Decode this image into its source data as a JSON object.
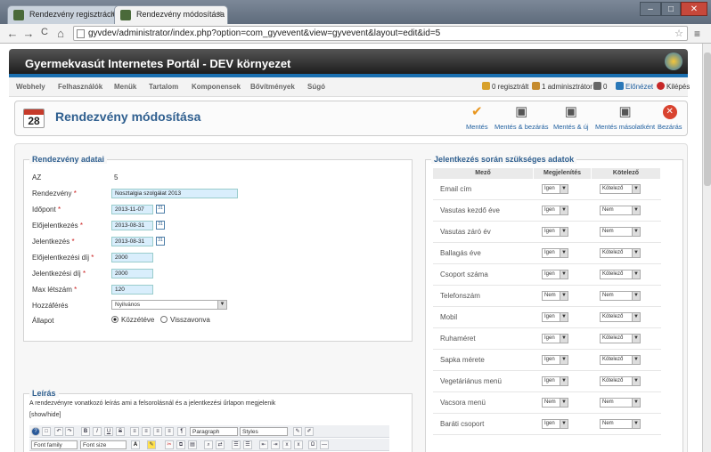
{
  "browser": {
    "tabs": [
      {
        "label": "Rendezvény regisztráció",
        "close": "×"
      },
      {
        "label": "Rendezvény módosítása",
        "close": "×"
      }
    ],
    "window_buttons": {
      "minimize": "–",
      "maximize": "□",
      "close": "✕"
    },
    "nav": {
      "back": "←",
      "forward": "→",
      "reload": "C",
      "home": "⌂"
    },
    "url": "gyvdev/administrator/index.php?option=com_gyvevent&view=gyvevent&layout=edit&id=5",
    "star": "☆",
    "menu": "≡"
  },
  "site": {
    "title": "Gyermekvasút Internetes Portál - DEV környezet"
  },
  "topmenu": {
    "items": [
      "Webhely",
      "Felhasználók",
      "Menük",
      "Tartalom",
      "Komponensek",
      "Bővítmények",
      "Súgó"
    ],
    "status": [
      {
        "label": "0 regisztrált",
        "color": "#d8a12b"
      },
      {
        "label": "1 adminisztrátor",
        "color": "#c58b2e"
      },
      {
        "label": "0",
        "color": "#666666"
      },
      {
        "label": "Előnézet",
        "color": "#2a78b8"
      },
      {
        "label": "Kilépés",
        "color": "#c62828"
      }
    ]
  },
  "titlebar": {
    "day": "28",
    "title": "Rendezvény módosítása",
    "buttons": [
      {
        "label": "Mentés",
        "icon": "✔",
        "color": "#e8961e"
      },
      {
        "label": "Mentés & bezárás",
        "icon": "▣",
        "color": "#555555"
      },
      {
        "label": "Mentés & új",
        "icon": "▣",
        "color": "#555555"
      },
      {
        "label": "Mentés másolatként",
        "icon": "▣",
        "color": "#555555"
      },
      {
        "label": "Bezárás",
        "icon": "✕",
        "color": "#d9432f"
      }
    ]
  },
  "event": {
    "legend": "Rendezvény adatai",
    "req": "*",
    "id_label": "AZ",
    "id_value": "5",
    "name_label": "Rendezvény",
    "name_value": "Nosztalgia szolgálat 2013",
    "date_label": "Időpont",
    "date_value": "2013-11-07",
    "prereg_label": "Előjelentkezés",
    "prereg_value": "2013-08-31",
    "reg_label": "Jelentkezés",
    "reg_value": "2013-08-31",
    "prefee_label": "Előjelentkezési díj",
    "prefee_value": "2000",
    "fee_label": "Jelentkezési díj",
    "fee_value": "2000",
    "max_label": "Max létszám",
    "max_value": "120",
    "access_label": "Hozzáférés",
    "access_value": "Nyilvános",
    "state_label": "Állapot",
    "state_published": "Közzétéve",
    "state_revoked": "Visszavonva",
    "cal_icon": "31"
  },
  "description": {
    "legend": "Leírás",
    "text": "A rendezvényre vonatkozó leírás ami a felsorolásnál és a jelentkezési űrlapon megjelenik",
    "toggle": "[show/hide]",
    "paragraph": "Paragraph",
    "styles": "Styles",
    "font_family": "Font family",
    "font_size": "Font size"
  },
  "requirements": {
    "legend": "Jelentkezés során szükséges adatok",
    "headers": [
      "Mező",
      "Megjelenítés",
      "Kötelező"
    ],
    "rows": [
      {
        "field": "Email cím",
        "show": "Igen",
        "req": "Kötelező"
      },
      {
        "field": "Vasutas kezdő éve",
        "show": "Igen",
        "req": "Nem"
      },
      {
        "field": "Vasutas záró év",
        "show": "Igen",
        "req": "Nem"
      },
      {
        "field": "Ballagás éve",
        "show": "Igen",
        "req": "Kötelező"
      },
      {
        "field": "Csoport száma",
        "show": "Igen",
        "req": "Kötelező"
      },
      {
        "field": "Telefonszám",
        "show": "Nem",
        "req": "Nem"
      },
      {
        "field": "Mobil",
        "show": "Igen",
        "req": "Kötelező"
      },
      {
        "field": "Ruhaméret",
        "show": "Igen",
        "req": "Kötelező"
      },
      {
        "field": "Sapka mérete",
        "show": "Igen",
        "req": "Kötelező"
      },
      {
        "field": "Vegetáriánus menü",
        "show": "Igen",
        "req": "Kötelező"
      },
      {
        "field": "Vacsora menü",
        "show": "Nem",
        "req": "Nem"
      },
      {
        "field": "Baráti csoport",
        "show": "Igen",
        "req": "Nem"
      }
    ]
  }
}
